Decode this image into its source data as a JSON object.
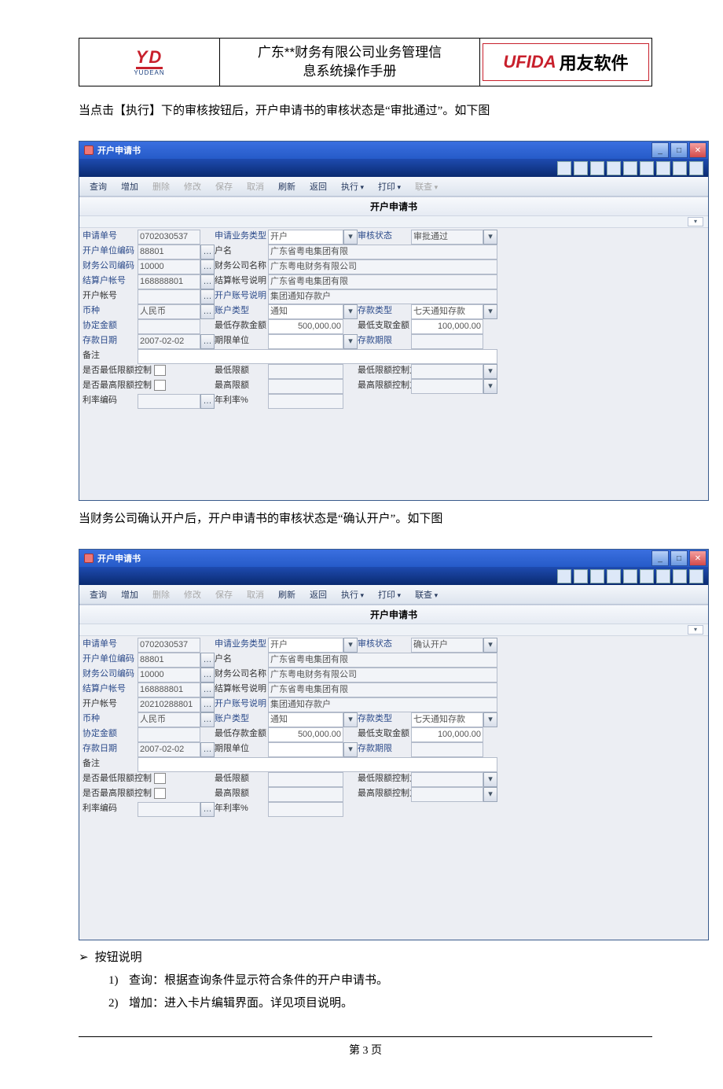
{
  "header": {
    "doc_title_line1": "广东**财务有限公司业务管理信",
    "doc_title_line2": "息系统操作手册",
    "yudean_abbr": "YD",
    "yudean_sub": "YUDEAN",
    "ufida_en": "UFIDA",
    "ufida_cn": "用友软件"
  },
  "paragraph1": "当点击【执行】下的审核按钮后，开户申请书的审核状态是“审批通过”。如下图",
  "paragraph2": "当财务公司确认开户后，开户申请书的审核状态是“确认开户”。如下图",
  "buttons_section_title": "按钮说明",
  "buttons_list": [
    "查询：根据查询条件显示符合条件的开户申请书。",
    "增加：进入卡片编辑界面。详见项目说明。"
  ],
  "footer": "第 3 页",
  "window_title": "开户申请书",
  "section_title": "开户申请书",
  "win_btns": {
    "min": "_",
    "max": "□",
    "close": "✕"
  },
  "toolbar": {
    "query": "查询",
    "add": "增加",
    "del": "删除",
    "edit": "修改",
    "save": "保存",
    "cancel": "取消",
    "refresh": "刷新",
    "back": "返回",
    "exec": "执行",
    "print": "打印",
    "linkq": "联查"
  },
  "labels": {
    "apply_no": "申请单号",
    "biz_type": "申请业务类型",
    "audit_status": "审核状态",
    "unit_code": "开户单位编码",
    "acct_name": "户名",
    "fin_code": "财务公司编码",
    "fin_name": "财务公司名称",
    "settle_acct": "结算户帐号",
    "settle_desc": "结算帐号说明",
    "open_acct": "开户帐号",
    "open_desc": "开户账号说明",
    "currency": "币种",
    "acct_type": "账户类型",
    "deposit_type": "存款类型",
    "agreed_amt": "协定金额",
    "min_deposit": "最低存款金额",
    "min_draw": "最低支取金额",
    "dep_date": "存款日期",
    "term_unit": "期限单位",
    "dep_term": "存款期限",
    "remark": "备注",
    "min_ctrl": "是否最低限额控制",
    "min_limit": "最低限额",
    "min_mode": "最低限额控制方式",
    "max_ctrl": "是否最高限额控制",
    "max_limit": "最高限额",
    "max_mode": "最高限额控制方式",
    "rate_code": "利率编码",
    "year_rate": "年利率%"
  },
  "dlg1": {
    "apply_no": "0702030537",
    "biz_type": "开户",
    "audit_status": "审批通过",
    "unit_code": "88801",
    "acct_name": "广东省粤电集团有限",
    "fin_code": "10000",
    "fin_name": "广东粤电财务有限公司",
    "settle_acct": "168888801",
    "settle_desc": "广东省粤电集团有限",
    "open_acct": "",
    "open_desc": "集团通知存款户",
    "currency": "人民币",
    "acct_type": "通知",
    "deposit_type": "七天通知存款",
    "agreed_amt": "",
    "min_deposit": "500,000.00",
    "min_draw": "100,000.00",
    "dep_date": "2007-02-02",
    "term_unit": "",
    "dep_term": "",
    "remark": "",
    "min_limit": "",
    "min_mode": "",
    "max_limit": "",
    "max_mode": "",
    "rate_code": "",
    "year_rate": ""
  },
  "dlg2": {
    "apply_no": "0702030537",
    "biz_type": "开户",
    "audit_status": "确认开户",
    "unit_code": "88801",
    "acct_name": "广东省粤电集团有限",
    "fin_code": "10000",
    "fin_name": "广东粤电财务有限公司",
    "settle_acct": "168888801",
    "settle_desc": "广东省粤电集团有限",
    "open_acct": "20210288801",
    "open_desc": "集团通知存款户",
    "currency": "人民币",
    "acct_type": "通知",
    "deposit_type": "七天通知存款",
    "agreed_amt": "",
    "min_deposit": "500,000.00",
    "min_draw": "100,000.00",
    "dep_date": "2007-02-02",
    "term_unit": "",
    "dep_term": "",
    "remark": "",
    "min_limit": "",
    "min_mode": "",
    "max_limit": "",
    "max_mode": "",
    "rate_code": "",
    "year_rate": ""
  }
}
